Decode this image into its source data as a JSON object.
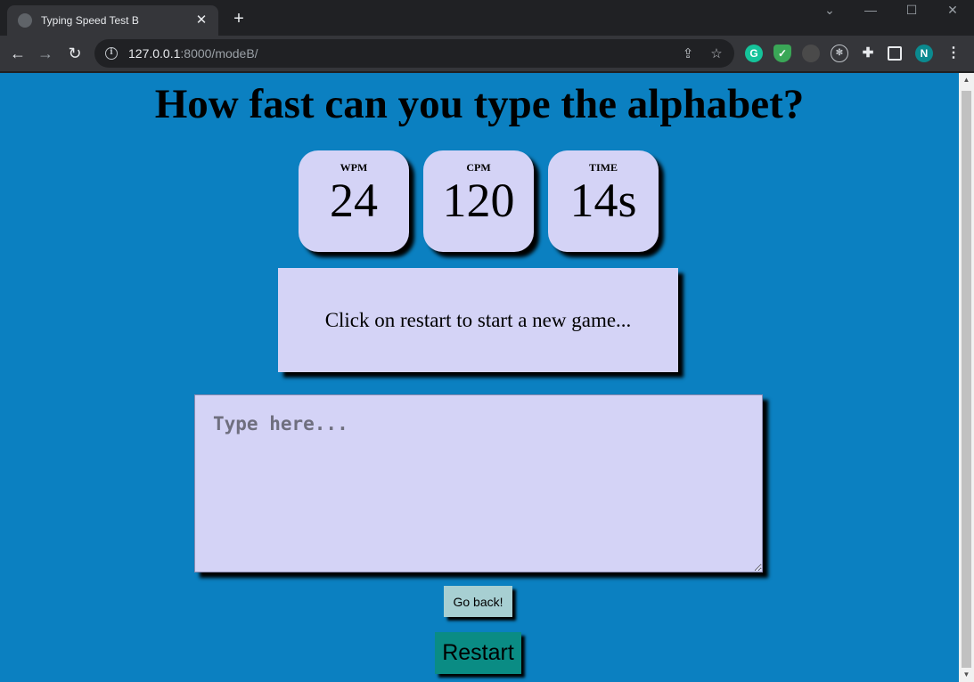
{
  "browser": {
    "tab_title": "Typing Speed Test B",
    "tab_close": "✕",
    "new_tab": "+",
    "url_host": "127.0.0.1",
    "url_rest": ":8000/modeB/",
    "profile_initial": "N"
  },
  "page": {
    "heading": "How fast can you type the alphabet?",
    "stats": [
      {
        "label": "WPM",
        "value": "24"
      },
      {
        "label": "CPM",
        "value": "120"
      },
      {
        "label": "TIME",
        "value": "14s"
      }
    ],
    "quote": "Click on restart to start a new game...",
    "input_placeholder": "Type here...",
    "back_button": "Go back!",
    "restart_button": "Restart"
  },
  "colors": {
    "page_background": "#0b80c1",
    "card_background": "#d4d3f6",
    "back_button": "#a7cfd2",
    "restart_button": "#0a8c84"
  }
}
